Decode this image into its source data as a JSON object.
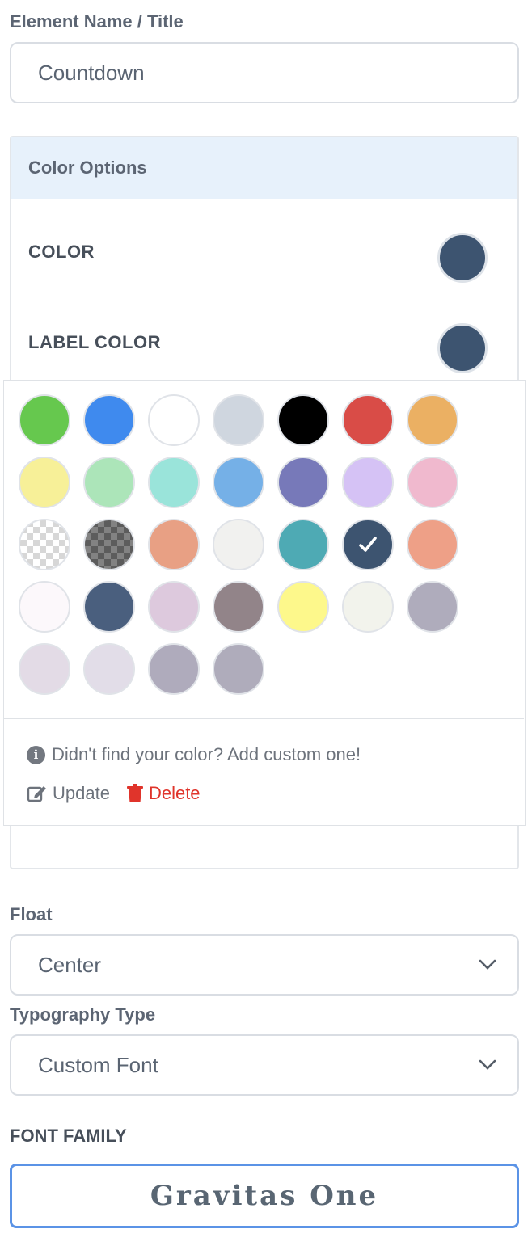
{
  "element_name": {
    "label": "Element Name / Title",
    "value": "Countdown"
  },
  "color_options": {
    "title": "Color Options",
    "color_label": "COLOR",
    "color_value": "#3d5470",
    "label_color_label": "LABEL COLOR",
    "label_color_value": "#3d5470"
  },
  "palette": {
    "swatches": [
      "#66c84e",
      "#3f8aee",
      "#ffffff",
      "#cfd6df",
      "#000000",
      "#d94c47",
      "#ebb063",
      "#f7f098",
      "#ace5b9",
      "#9ae4da",
      "#75b0e7",
      "#7779b9",
      "#d5c2f5",
      "#f0b9ce",
      "transparent",
      "transparent-dark",
      "#e8a084",
      "#f1f1ef",
      "#4eaab4",
      "#3d5470",
      "#eea087",
      "#fcf8fb",
      "#4a5f7e",
      "#ddc9dd",
      "#928489",
      "#fdf88b",
      "#f2f3ec",
      "#afacbc",
      "#e3dbe6",
      "#e2dde8",
      "#afabbc",
      "#afacbb"
    ],
    "selected_index": 19,
    "info_text": "Didn't find your color? Add custom one!",
    "update_label": "Update",
    "delete_label": "Delete"
  },
  "float": {
    "label": "Float",
    "value": "Center"
  },
  "typography": {
    "label": "Typography Type",
    "value": "Custom Font"
  },
  "font_family": {
    "label": "FONT FAMILY",
    "value": "Gravitas One"
  },
  "colors": {
    "accent_border": "#5b93e6",
    "delete": "#e0342b",
    "panel_header_bg": "#e7f1fb"
  }
}
